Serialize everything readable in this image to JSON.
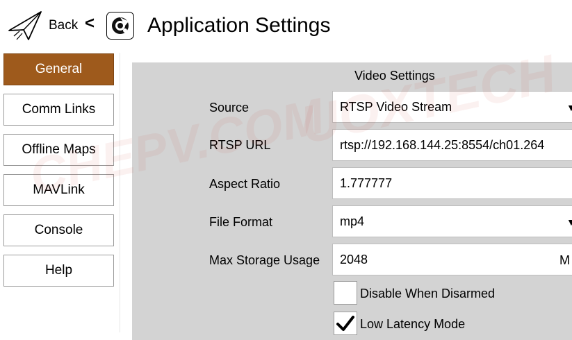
{
  "header": {
    "back_label": "Back",
    "lt_glyph": "<",
    "title": "Application Settings"
  },
  "sidebar": {
    "items": [
      {
        "label": "General",
        "active": true
      },
      {
        "label": "Comm Links"
      },
      {
        "label": "Offline Maps"
      },
      {
        "label": "MAVLink"
      },
      {
        "label": "Console"
      },
      {
        "label": "Help"
      }
    ]
  },
  "video": {
    "section_title": "Video Settings",
    "source_label": "Source",
    "source_value": "RTSP Video Stream",
    "rtsp_label": "RTSP URL",
    "rtsp_value": "rtsp://192.168.144.25:8554/ch01.264",
    "aspect_label": "Aspect Ratio",
    "aspect_value": "1.777777",
    "format_label": "File Format",
    "format_value": "mp4",
    "storage_label": "Max Storage Usage",
    "storage_value": "2048",
    "storage_unit": "M",
    "disable_label": "Disable When Disarmed",
    "disable_checked": false,
    "latency_label": "Low Latency Mode",
    "latency_checked": true
  },
  "watermark": {
    "left_text": "CHEPV.COM",
    "right_text": "UOXTECH"
  },
  "colors": {
    "accent": "#9e5a1c",
    "panel_bg": "#d3d3d3",
    "border": "#9a9a9a"
  },
  "icons": [
    "paper-plane-icon",
    "less-than-glyph",
    "qgc-settings-icon",
    "dropdown-caret-icon",
    "checkmark-icon"
  ]
}
